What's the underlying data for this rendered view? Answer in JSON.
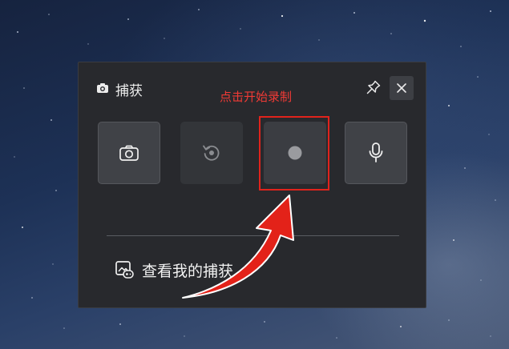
{
  "panel": {
    "title": "捕获",
    "annotation": "点击开始录制",
    "annotation_color": "#f03a35",
    "highlight_color": "#e0231c",
    "buttons": [
      {
        "name": "screenshot",
        "icon": "camera-icon"
      },
      {
        "name": "replay",
        "icon": "replay-icon"
      },
      {
        "name": "record",
        "icon": "record-dot-icon"
      },
      {
        "name": "microphone",
        "icon": "microphone-icon"
      }
    ],
    "gallery_label": "查看我的捕获"
  }
}
